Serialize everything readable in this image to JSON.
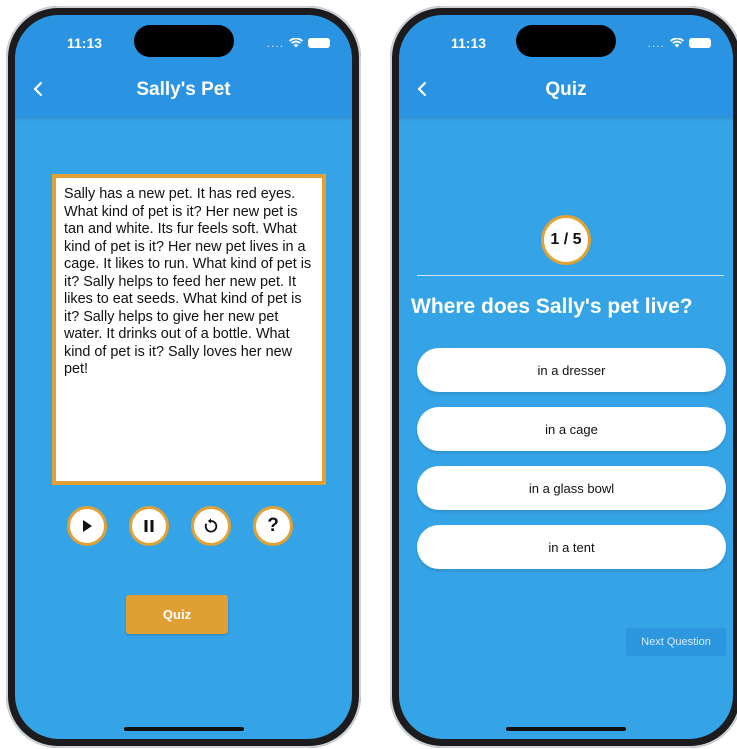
{
  "status": {
    "time": "11:13",
    "signal_dots": "...."
  },
  "story_screen": {
    "title": "Sally's Pet",
    "story_text": "Sally has a new pet. It has red eyes. What kind of pet is it? Her new pet is tan and white. Its fur feels soft. What kind of pet is it? Her new pet lives in a cage. It likes to run. What kind of pet is it? Sally helps to feed her new pet. It likes to eat seeds. What kind of pet is it? Sally helps to give her new pet water. It drinks out of a bottle. What kind of pet is it? Sally loves her new pet!",
    "controls": [
      {
        "icon": "play-icon"
      },
      {
        "icon": "pause-icon"
      },
      {
        "icon": "replay-icon"
      },
      {
        "icon": "help-icon",
        "glyph": "?"
      }
    ],
    "quiz_label": "Quiz"
  },
  "quiz_screen": {
    "title": "Quiz",
    "progress": "1 / 5",
    "question": "Where does Sally's pet live?",
    "answers": [
      "in a dresser",
      "in a cage",
      "in a glass bowl",
      "in a tent"
    ],
    "next_label": "Next Question"
  },
  "colors": {
    "primary": "#2a93e2",
    "background": "#35a4e6",
    "accent": "#e0a235"
  }
}
